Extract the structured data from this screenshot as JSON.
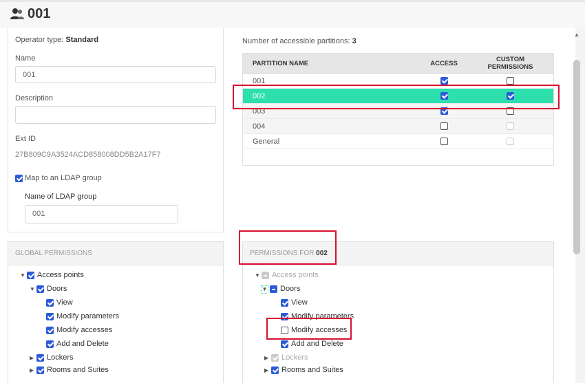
{
  "header": {
    "title": "001",
    "icon": "operators-icon"
  },
  "operator": {
    "type_label": "Operator type:",
    "type_value": "Standard",
    "name_label": "Name",
    "name_value": "001",
    "description_label": "Description",
    "description_value": "",
    "extid_label": "Ext ID",
    "extid_value": "27B809C9A3524ACD858008DD5B2A17F7",
    "ldap_map_label": "Map to an LDAP group",
    "ldap_map_checked": true,
    "ldap_group_label": "Name of LDAP group",
    "ldap_group_value": "001"
  },
  "partitions": {
    "count_label": "Number of accessible partitions:",
    "count_value": "3",
    "columns": [
      "PARTITION NAME",
      "ACCESS",
      "CUSTOM PERMISSIONS"
    ],
    "rows": [
      {
        "name": "001",
        "access": true,
        "custom": false
      },
      {
        "name": "002",
        "access": true,
        "custom": true,
        "selected": true
      },
      {
        "name": "003",
        "access": true,
        "custom": false
      },
      {
        "name": "004",
        "access": false,
        "custom": false
      },
      {
        "name": "General",
        "access": false,
        "custom": false
      }
    ]
  },
  "global_permissions": {
    "title": "GLOBAL PERMISSIONS",
    "items": [
      "Access points",
      "Doors",
      "View",
      "Modify parameters",
      "Modify accesses",
      "Add and Delete",
      "Lockers",
      "Rooms and Suites"
    ]
  },
  "partition_permissions": {
    "title_prefix": "PERMISSIONS FOR",
    "title_partition": "002",
    "items": [
      "Access points",
      "Doors",
      "View",
      "Modify parameters",
      "Modify accesses",
      "Add and Delete",
      "Lockers",
      "Rooms and Suites"
    ]
  },
  "colors": {
    "selected_row": "#2ddfad",
    "accent": "#2b5bd7",
    "highlight_box": "#d8102f"
  }
}
